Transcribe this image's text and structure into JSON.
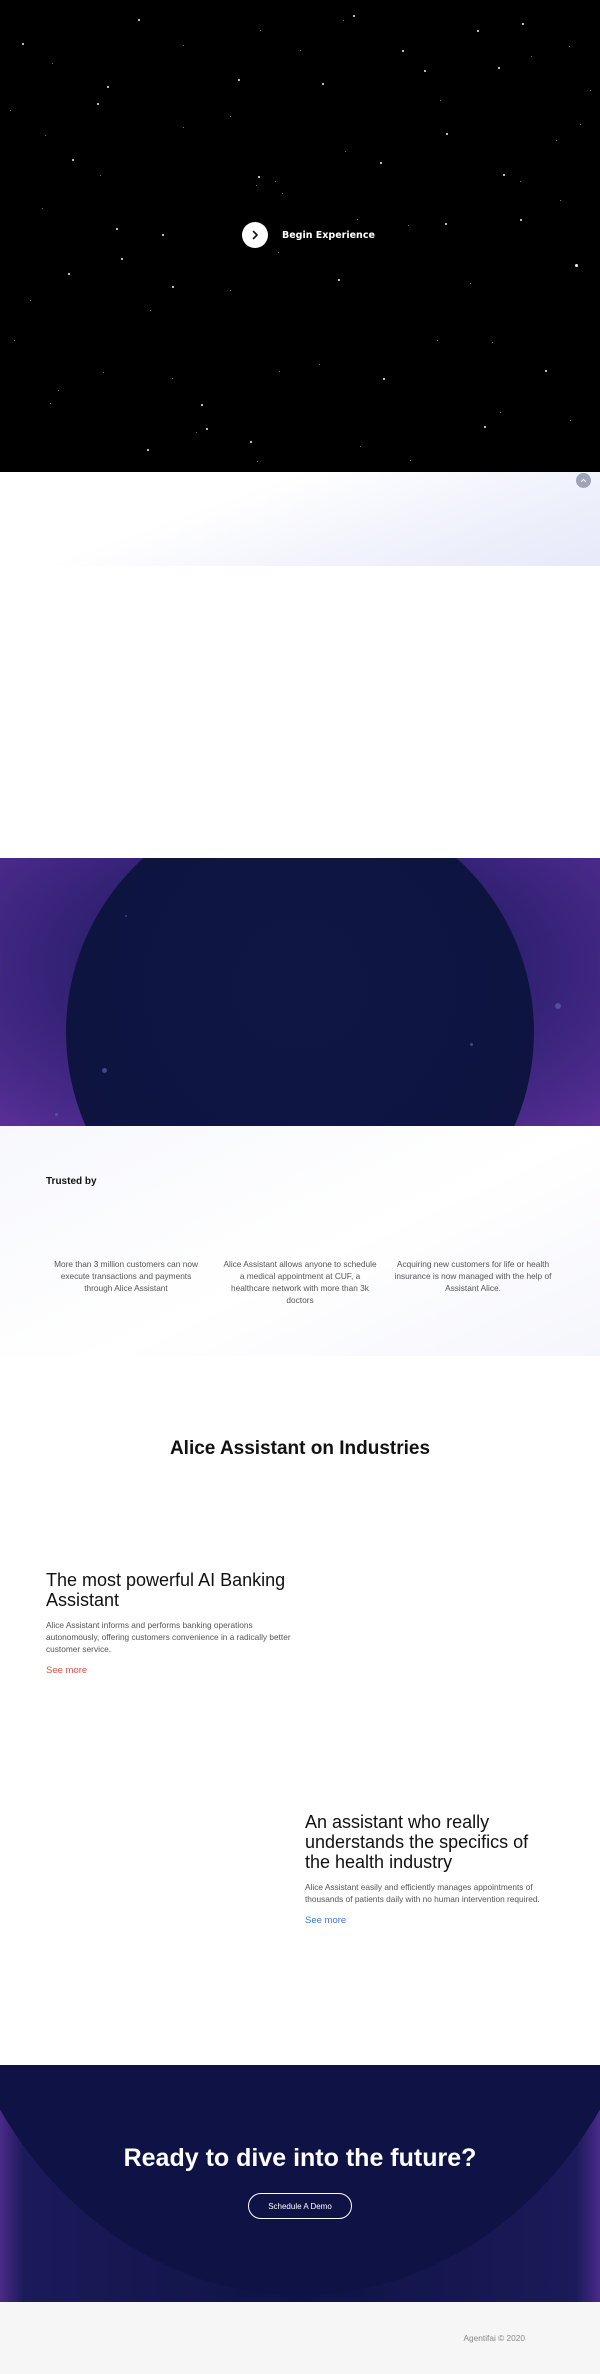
{
  "hero": {
    "begin_label": "Begin Experience",
    "arrow_icon": "chevron-right-icon"
  },
  "scroll_icon": "chevron-up-icon",
  "trusted": {
    "title": "Trusted by",
    "items": [
      "More than 3 million customers can now execute transactions and payments through Alice Assistant",
      "Alice Assistant allows anyone to schedule a medical appointment at CUF, a healthcare network with more than 3k doctors",
      "Acquiring new customers for life or health insurance is now managed with the help of Assistant Alice."
    ]
  },
  "industries": {
    "title": "Alice Assistant on Industries",
    "banking": {
      "heading": "The most powerful AI Banking Assistant",
      "text": "Alice Assistant informs and performs banking operations autonomously, offering customers convenience in a radically better customer service.",
      "link": "See more",
      "link_color": "#e0533d"
    },
    "health": {
      "heading": "An assistant who really understands the specifics of the health industry",
      "text": "Alice Assistant easily and efficiently manages appointments of thousands of patients daily with no human intervention required.",
      "link": "See more",
      "link_color": "#3a7bd5"
    }
  },
  "cta": {
    "title": "Ready to dive into the future?",
    "button": "Schedule A Demo"
  },
  "footer": {
    "copyright": "Agentifai © 2020"
  }
}
